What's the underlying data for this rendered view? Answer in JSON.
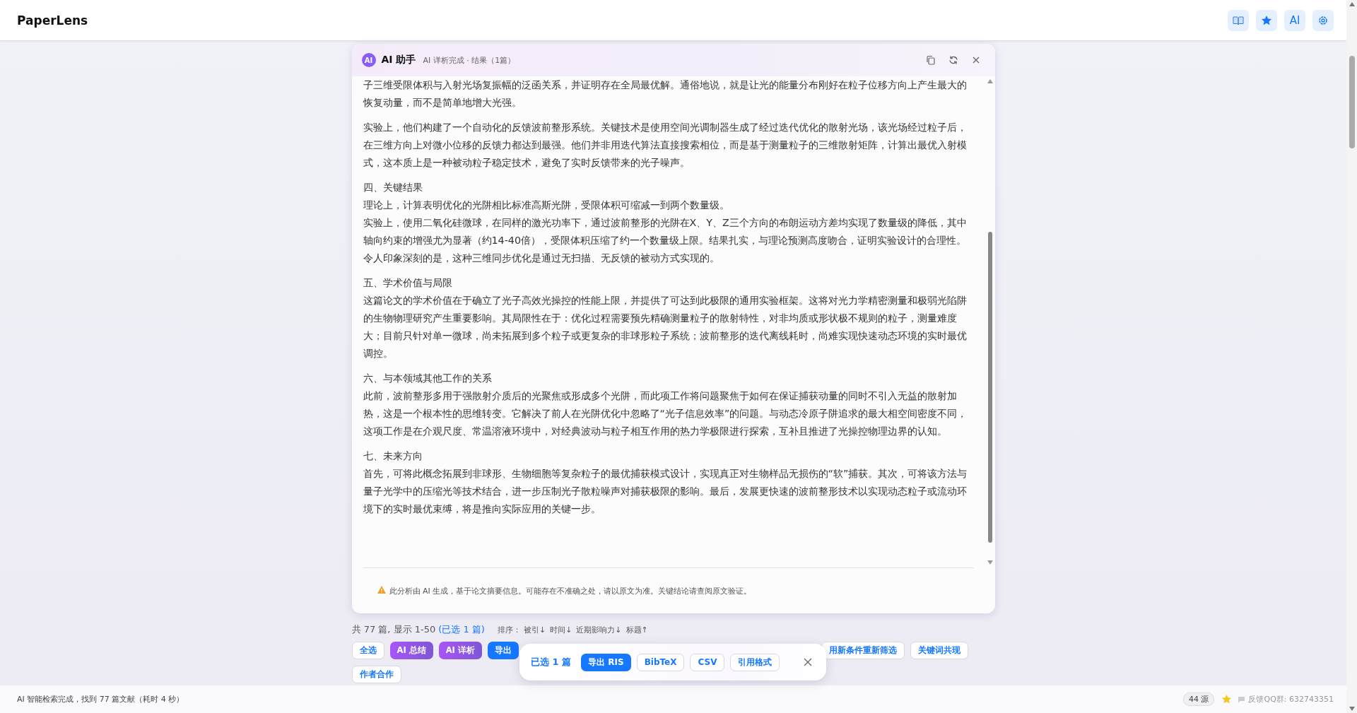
{
  "app": {
    "title": "PaperLens",
    "ai_button": "AI"
  },
  "dialog": {
    "badge": "AI",
    "title": "AI 助手",
    "subtitle": "AI 详析完成 · 结果（1篇）",
    "sections": [
      {
        "paragraphs": [
          "子三维受限体积与入射光场复振幅的泛函关系，并证明存在全局最优解。通俗地说，就是让光的能量分布刚好在粒子位移方向上产生最大的恢复动量，而不是简单地增大光强。"
        ]
      },
      {
        "paragraphs": [
          "实验上，他们构建了一个自动化的反馈波前整形系统。关键技术是使用空间光调制器生成了经过迭代优化的散射光场，该光场经过粒子后，在三维方向上对微小位移的反馈力都达到最强。他们并非用迭代算法直接搜索相位，而是基于测量粒子的三维散射矩阵，计算出最优入射模式，这本质上是一种被动粒子稳定技术，避免了实时反馈带来的光子噪声。"
        ]
      },
      {
        "heading": "四、关键结果",
        "paragraphs": [
          "理论上，计算表明优化的光阱相比标准高斯光阱，受限体积可缩减一到两个数量级。",
          "实验上，使用二氧化硅微球，在同样的激光功率下，通过波前整形的光阱在X、Y、Z三个方向的布朗运动方差均实现了数量级的降低，其中轴向约束的增强尤为显著（约14-40倍），受限体积压缩了约一个数量级上限。结果扎实，与理论预测高度吻合，证明实验设计的合理性。令人印象深刻的是，这种三维同步优化是通过无扫描、无反馈的被动方式实现的。"
        ]
      },
      {
        "heading": "五、学术价值与局限",
        "paragraphs": [
          "这篇论文的学术价值在于确立了光子高效光操控的性能上限，并提供了可达到此极限的通用实验框架。这将对光力学精密测量和极弱光陷阱的生物物理研究产生重要影响。其局限性在于：优化过程需要预先精确测量粒子的散射特性，对非均质或形状极不规则的粒子，测量难度大；目前只针对单一微球，尚未拓展到多个粒子或更复杂的非球形粒子系统；波前整形的迭代离线耗时，尚难实现快速动态环境的实时最优调控。"
        ]
      },
      {
        "heading": "六、与本领域其他工作的关系",
        "paragraphs": [
          "此前，波前整形多用于强散射介质后的光聚焦或形成多个光阱，而此项工作将问题聚焦于如何在保证捕获动量的同时不引入无益的散射加热，这是一个根本性的思维转变。它解决了前人在光阱优化中忽略了“光子信息效率”的问题。与动态冷原子阱追求的最大相空间密度不同，这项工作是在介观尺度、常温溶液环境中，对经典波动与粒子相互作用的热力学极限进行探索，互补且推进了光操控物理边界的认知。"
        ]
      },
      {
        "heading": "七、未来方向",
        "paragraphs": [
          "首先，可将此概念拓展到非球形、生物细胞等复杂粒子的最优捕获模式设计，实现真正对生物样品无损伤的“软”捕获。其次，可将该方法与量子光学中的压缩光等技术结合，进一步压制光子散粒噪声对捕获极限的影响。最后，发展更快速的波前整形技术以实现动态粒子或流动环境下的实时最优束缚，将是推向实际应用的关键一步。"
        ]
      }
    ],
    "disclaimer": "此分析由 AI 生成，基于论文摘要信息。可能存在不准确之处，请以原文为准。关键结论请查阅原文验证。"
  },
  "results": {
    "summary": "共 77 篇, 显示 1-50",
    "selected_link": "(已选 1 篇)",
    "sort_label": "排序：",
    "sort_options": [
      "被引↓",
      "时间↓",
      "近期影响力↓",
      "标题↑"
    ],
    "actions": [
      {
        "label": "全选",
        "kind": "plain"
      },
      {
        "label": "AI 总结",
        "kind": "ai"
      },
      {
        "label": "AI 详析",
        "kind": "ai"
      },
      {
        "label": "导出",
        "kind": "primary"
      },
      {
        "label": "用新条件重新筛选",
        "kind": "plain"
      },
      {
        "label": "关键词共现",
        "kind": "plain"
      },
      {
        "label": "作者合作",
        "kind": "plain"
      }
    ]
  },
  "selection_bar": {
    "count": "已选 1 篇",
    "buttons": [
      {
        "label": "导出 RIS",
        "kind": "primary"
      },
      {
        "label": "BibTeX",
        "kind": "plain"
      },
      {
        "label": "CSV",
        "kind": "plain"
      },
      {
        "label": "引用格式",
        "kind": "plain"
      }
    ]
  },
  "status_bar": {
    "message": "AI 智能检索完成，找到 77 篇文献（耗时 4 秒）",
    "source_count": "44 源",
    "feedback": "反馈QQ群: 632743351"
  }
}
